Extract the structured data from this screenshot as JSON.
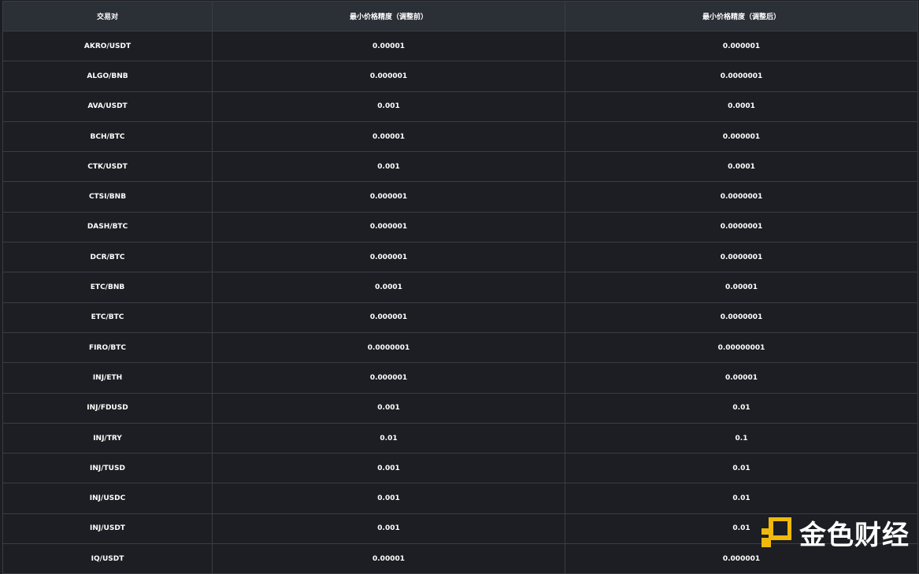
{
  "table": {
    "headers": [
      "交易对",
      "最小价格精度（调整前）",
      "最小价格精度（调整后）"
    ],
    "rows": [
      [
        "AKRO/USDT",
        "0.00001",
        "0.000001"
      ],
      [
        "ALGO/BNB",
        "0.000001",
        "0.0000001"
      ],
      [
        "AVA/USDT",
        "0.001",
        "0.0001"
      ],
      [
        "BCH/BTC",
        "0.00001",
        "0.000001"
      ],
      [
        "CTK/USDT",
        "0.001",
        "0.0001"
      ],
      [
        "CTSI/BNB",
        "0.000001",
        "0.0000001"
      ],
      [
        "DASH/BTC",
        "0.000001",
        "0.0000001"
      ],
      [
        "DCR/BTC",
        "0.000001",
        "0.0000001"
      ],
      [
        "ETC/BNB",
        "0.0001",
        "0.00001"
      ],
      [
        "ETC/BTC",
        "0.000001",
        "0.0000001"
      ],
      [
        "FIRO/BTC",
        "0.0000001",
        "0.00000001"
      ],
      [
        "INJ/ETH",
        "0.000001",
        "0.00001"
      ],
      [
        "INJ/FDUSD",
        "0.001",
        "0.01"
      ],
      [
        "INJ/TRY",
        "0.01",
        "0.1"
      ],
      [
        "INJ/TUSD",
        "0.001",
        "0.01"
      ],
      [
        "INJ/USDC",
        "0.001",
        "0.01"
      ],
      [
        "INJ/USDT",
        "0.001",
        "0.01"
      ],
      [
        "IQ/USDT",
        "0.00001",
        "0.000001"
      ]
    ]
  },
  "watermark": {
    "text": "金色财经",
    "logo_icon": "jinse-logo-icon",
    "logo_color": "#f0b90b"
  }
}
